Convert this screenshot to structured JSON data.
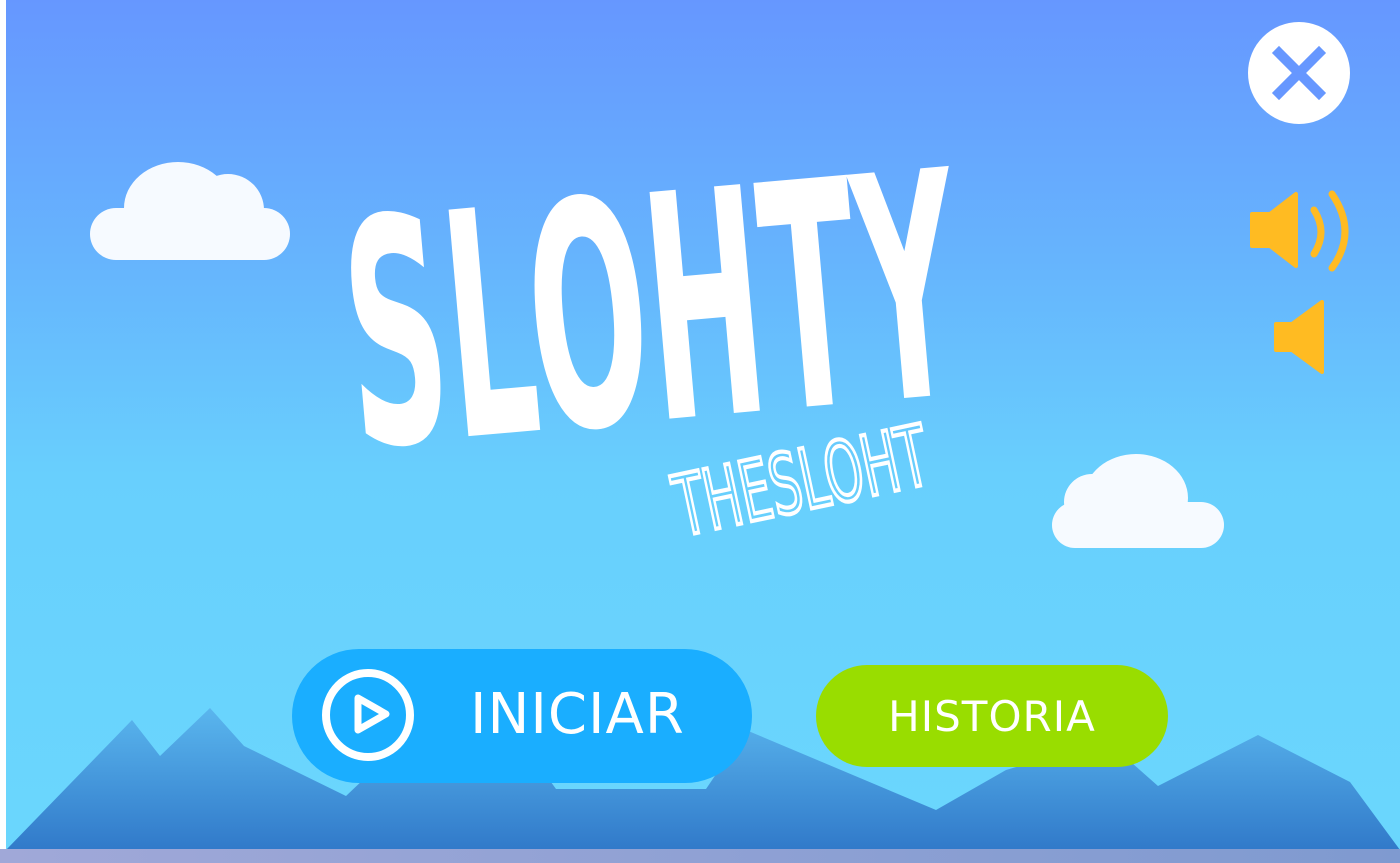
{
  "game": {
    "title": "SLOHTY",
    "subtitle": "THESLOHT"
  },
  "controls": {
    "close_icon": "close-x-icon",
    "sound_on_icon": "speaker-on-icon",
    "sound_off_icon": "speaker-off-icon"
  },
  "menu": {
    "start_label": "INICIAR",
    "start_icon": "play-icon",
    "story_label": "HISTORIA"
  },
  "colors": {
    "sky_top": "#6697ff",
    "sky_bottom": "#6ad7fd",
    "start_button": "#1aaeff",
    "story_button": "#99dd00",
    "speaker": "#ffbb22",
    "close_x": "#6697ff",
    "mountains": "#3f86d6"
  }
}
